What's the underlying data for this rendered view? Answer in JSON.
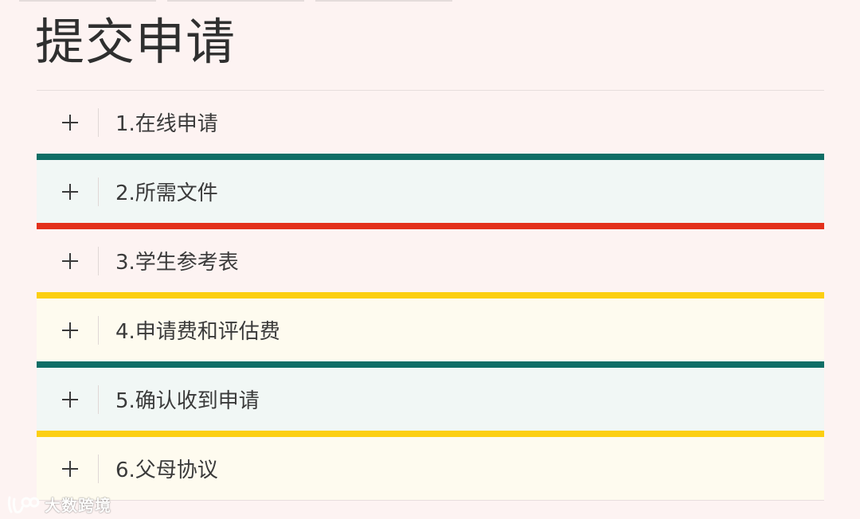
{
  "title": "提交申请",
  "colors": {
    "page_background": "#fdf3f2",
    "teal": "#0f6e66",
    "red": "#e3311c",
    "yellow": "#fccf12",
    "row_teal_tint": "#f1f7f5",
    "row_yellow_tint": "#fefbef",
    "row_plain": "#fdf3f2"
  },
  "accordion": {
    "items": [
      {
        "label": "1.在线申请",
        "expanded": false,
        "icon": "plus-icon",
        "background": "#fdf3f2",
        "separator_color": "#0f6e66"
      },
      {
        "label": "2.所需文件",
        "expanded": false,
        "icon": "plus-icon",
        "background": "#f1f7f5",
        "separator_color": "#e3311c"
      },
      {
        "label": "3.学生参考表",
        "expanded": false,
        "icon": "plus-icon",
        "background": "#fdf3f2",
        "separator_color": "#fccf12"
      },
      {
        "label": "4.申请费和评估费",
        "expanded": false,
        "icon": "plus-icon",
        "background": "#fefbef",
        "separator_color": "#0f6e66"
      },
      {
        "label": "5.确认收到申请",
        "expanded": false,
        "icon": "plus-icon",
        "background": "#f1f7f5",
        "separator_color": "#fccf12"
      },
      {
        "label": "6.父母协议",
        "expanded": false,
        "icon": "plus-icon",
        "background": "#fefbef",
        "separator_color": ""
      }
    ]
  },
  "watermark": {
    "text": "大数跨境",
    "icon": "brand-logo-icon"
  }
}
